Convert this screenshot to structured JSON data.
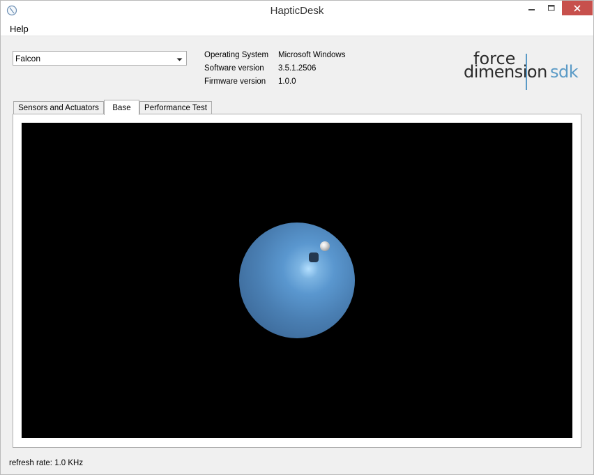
{
  "window": {
    "title": "HapticDesk"
  },
  "menu": {
    "items": [
      "Help"
    ]
  },
  "device": {
    "selected": "Falcon"
  },
  "info": {
    "rows": [
      {
        "label": "Operating System",
        "value": "Microsoft Windows"
      },
      {
        "label": "Software version",
        "value": "3.5.1.2506"
      },
      {
        "label": "Firmware version",
        "value": "1.0.0"
      }
    ]
  },
  "logo": {
    "line1": "force",
    "line2": "dimension",
    "suffix": "sdk",
    "accent_color": "#5a9ac6"
  },
  "tabs": [
    {
      "label": "Sensors and Actuators",
      "active": false
    },
    {
      "label": "Base",
      "active": true
    },
    {
      "label": "Performance Test",
      "active": false
    }
  ],
  "scene": {
    "background": "#000000",
    "sphere_color": "#4a84bd",
    "cursor_color": "#d8d8d8"
  },
  "status": {
    "text": "refresh rate: 1.0 KHz"
  }
}
